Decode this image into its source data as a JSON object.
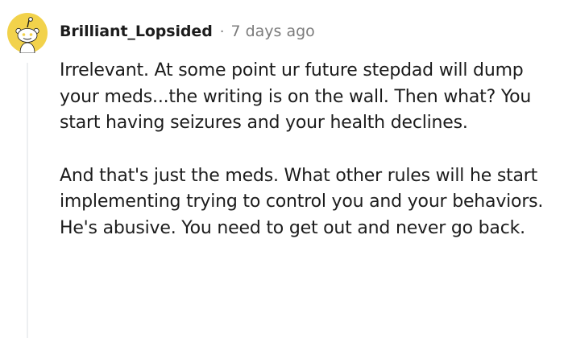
{
  "comment": {
    "author": "Brilliant_Lopsided",
    "separator": "·",
    "timestamp": "7 days ago",
    "avatar_icon": "reddit-snoo-avatar-icon",
    "colors": {
      "avatar_background": "#f2d24b",
      "text": "#1c1c1c",
      "meta": "#7c7c7c",
      "thread_line": "#edeff1"
    },
    "paragraphs": [
      "Irrelevant. At some point ur future stepdad will dump your meds...the writing is on the wall. Then what? You start having seizures and your health declines.",
      "And that's just the meds. What other rules will he start implementing trying to control you and your behaviors. He's abusive. You need to get out and never go back."
    ]
  }
}
